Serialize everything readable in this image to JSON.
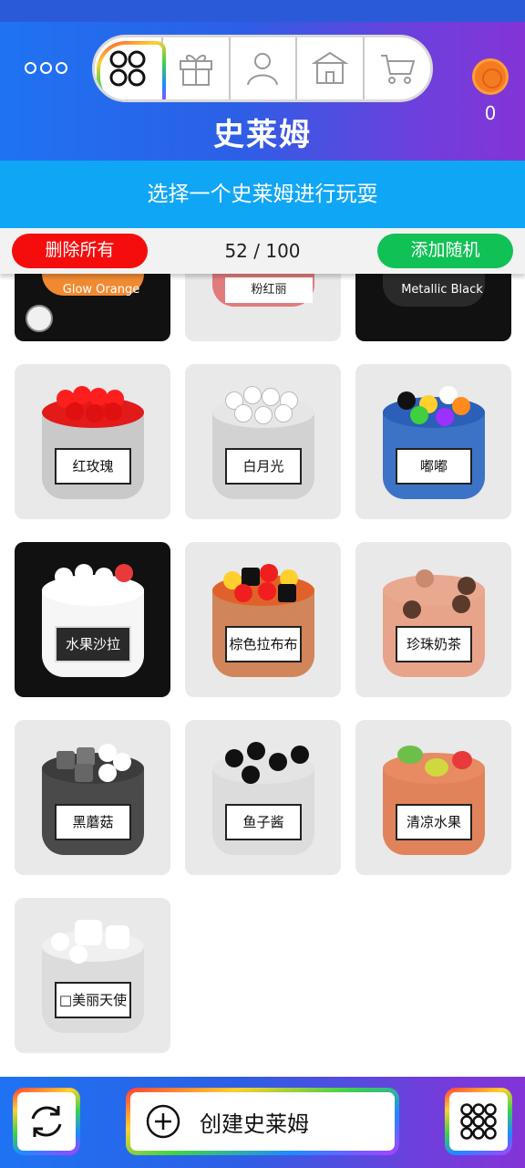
{
  "header": {
    "title": "史莱姆",
    "coin_count": "0",
    "nav_tabs": [
      {
        "name": "slimes",
        "icon": "four-circles-icon",
        "active": true
      },
      {
        "name": "gifts",
        "icon": "gift-icon",
        "active": false
      },
      {
        "name": "profile",
        "icon": "person-icon",
        "active": false
      },
      {
        "name": "store",
        "icon": "store-icon",
        "active": false
      },
      {
        "name": "cart",
        "icon": "cart-icon",
        "active": false
      }
    ]
  },
  "instruction": "选择一个史莱姆进行玩耍",
  "action_bar": {
    "delete_label": "删除所有",
    "counter": "52 / 100",
    "add_label": "添加随机"
  },
  "partial_row": [
    {
      "label": "Glow Orange",
      "color": "#f08a32"
    },
    {
      "label": "粉红丽",
      "color": "#e27b7b"
    },
    {
      "label": "Metallic Black",
      "color": "#2a2a2a"
    }
  ],
  "slimes": [
    {
      "label": "红玫瑰",
      "body": "#c9c9c9",
      "top": "#e21a1a",
      "ball": "#ff1e1e",
      "dark": false
    },
    {
      "label": "白月光",
      "body": "#d2d2d2",
      "top": "#e6e6e6",
      "ball": "#ffffff",
      "dark": false
    },
    {
      "label": "嘟嘟",
      "body": "#3d73c6",
      "top": "#2b5fb8",
      "ball": "#ffcf2e",
      "dark": false
    },
    {
      "label": "水果沙拉",
      "body": "#f6f6f6",
      "top": "#ffffff",
      "ball": "#ffffff",
      "dark": true
    },
    {
      "label": "棕色拉布布",
      "body": "#d0855a",
      "top": "#e0622a",
      "ball": "#f01e1e",
      "dark": false
    },
    {
      "label": "珍珠奶茶",
      "body": "#e7a48a",
      "top": "#e9a890",
      "ball": "#5a3a2a",
      "dark": false
    },
    {
      "label": "黑蘑菇",
      "body": "#4a4a4a",
      "top": "#3c3c3c",
      "ball": "#ffffff",
      "dark": false
    },
    {
      "label": "鱼子酱",
      "body": "#dcdcdc",
      "top": "#e4e4e4",
      "ball": "#111111",
      "dark": false
    },
    {
      "label": "清凉水果",
      "body": "#e0835a",
      "top": "#e88a62",
      "ball": "#6cc04a",
      "dark": false
    },
    {
      "label": "□美丽天使",
      "body": "#dcdcdc",
      "top": "#f0f0f0",
      "ball": "#ffffff",
      "dark": false
    }
  ],
  "bottom_bar": {
    "create_label": "创建史莱姆"
  }
}
